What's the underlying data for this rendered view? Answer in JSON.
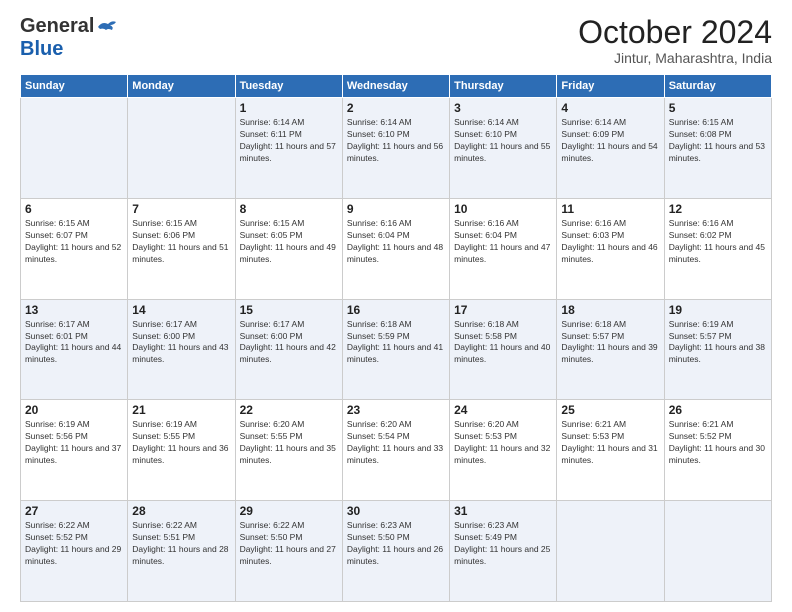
{
  "header": {
    "logo_general": "General",
    "logo_blue": "Blue",
    "month_title": "October 2024",
    "location": "Jintur, Maharashtra, India"
  },
  "days_of_week": [
    "Sunday",
    "Monday",
    "Tuesday",
    "Wednesday",
    "Thursday",
    "Friday",
    "Saturday"
  ],
  "weeks": [
    [
      {
        "day": "",
        "sunrise": "",
        "sunset": "",
        "daylight": ""
      },
      {
        "day": "",
        "sunrise": "",
        "sunset": "",
        "daylight": ""
      },
      {
        "day": "1",
        "sunrise": "Sunrise: 6:14 AM",
        "sunset": "Sunset: 6:11 PM",
        "daylight": "Daylight: 11 hours and 57 minutes."
      },
      {
        "day": "2",
        "sunrise": "Sunrise: 6:14 AM",
        "sunset": "Sunset: 6:10 PM",
        "daylight": "Daylight: 11 hours and 56 minutes."
      },
      {
        "day": "3",
        "sunrise": "Sunrise: 6:14 AM",
        "sunset": "Sunset: 6:10 PM",
        "daylight": "Daylight: 11 hours and 55 minutes."
      },
      {
        "day": "4",
        "sunrise": "Sunrise: 6:14 AM",
        "sunset": "Sunset: 6:09 PM",
        "daylight": "Daylight: 11 hours and 54 minutes."
      },
      {
        "day": "5",
        "sunrise": "Sunrise: 6:15 AM",
        "sunset": "Sunset: 6:08 PM",
        "daylight": "Daylight: 11 hours and 53 minutes."
      }
    ],
    [
      {
        "day": "6",
        "sunrise": "Sunrise: 6:15 AM",
        "sunset": "Sunset: 6:07 PM",
        "daylight": "Daylight: 11 hours and 52 minutes."
      },
      {
        "day": "7",
        "sunrise": "Sunrise: 6:15 AM",
        "sunset": "Sunset: 6:06 PM",
        "daylight": "Daylight: 11 hours and 51 minutes."
      },
      {
        "day": "8",
        "sunrise": "Sunrise: 6:15 AM",
        "sunset": "Sunset: 6:05 PM",
        "daylight": "Daylight: 11 hours and 49 minutes."
      },
      {
        "day": "9",
        "sunrise": "Sunrise: 6:16 AM",
        "sunset": "Sunset: 6:04 PM",
        "daylight": "Daylight: 11 hours and 48 minutes."
      },
      {
        "day": "10",
        "sunrise": "Sunrise: 6:16 AM",
        "sunset": "Sunset: 6:04 PM",
        "daylight": "Daylight: 11 hours and 47 minutes."
      },
      {
        "day": "11",
        "sunrise": "Sunrise: 6:16 AM",
        "sunset": "Sunset: 6:03 PM",
        "daylight": "Daylight: 11 hours and 46 minutes."
      },
      {
        "day": "12",
        "sunrise": "Sunrise: 6:16 AM",
        "sunset": "Sunset: 6:02 PM",
        "daylight": "Daylight: 11 hours and 45 minutes."
      }
    ],
    [
      {
        "day": "13",
        "sunrise": "Sunrise: 6:17 AM",
        "sunset": "Sunset: 6:01 PM",
        "daylight": "Daylight: 11 hours and 44 minutes."
      },
      {
        "day": "14",
        "sunrise": "Sunrise: 6:17 AM",
        "sunset": "Sunset: 6:00 PM",
        "daylight": "Daylight: 11 hours and 43 minutes."
      },
      {
        "day": "15",
        "sunrise": "Sunrise: 6:17 AM",
        "sunset": "Sunset: 6:00 PM",
        "daylight": "Daylight: 11 hours and 42 minutes."
      },
      {
        "day": "16",
        "sunrise": "Sunrise: 6:18 AM",
        "sunset": "Sunset: 5:59 PM",
        "daylight": "Daylight: 11 hours and 41 minutes."
      },
      {
        "day": "17",
        "sunrise": "Sunrise: 6:18 AM",
        "sunset": "Sunset: 5:58 PM",
        "daylight": "Daylight: 11 hours and 40 minutes."
      },
      {
        "day": "18",
        "sunrise": "Sunrise: 6:18 AM",
        "sunset": "Sunset: 5:57 PM",
        "daylight": "Daylight: 11 hours and 39 minutes."
      },
      {
        "day": "19",
        "sunrise": "Sunrise: 6:19 AM",
        "sunset": "Sunset: 5:57 PM",
        "daylight": "Daylight: 11 hours and 38 minutes."
      }
    ],
    [
      {
        "day": "20",
        "sunrise": "Sunrise: 6:19 AM",
        "sunset": "Sunset: 5:56 PM",
        "daylight": "Daylight: 11 hours and 37 minutes."
      },
      {
        "day": "21",
        "sunrise": "Sunrise: 6:19 AM",
        "sunset": "Sunset: 5:55 PM",
        "daylight": "Daylight: 11 hours and 36 minutes."
      },
      {
        "day": "22",
        "sunrise": "Sunrise: 6:20 AM",
        "sunset": "Sunset: 5:55 PM",
        "daylight": "Daylight: 11 hours and 35 minutes."
      },
      {
        "day": "23",
        "sunrise": "Sunrise: 6:20 AM",
        "sunset": "Sunset: 5:54 PM",
        "daylight": "Daylight: 11 hours and 33 minutes."
      },
      {
        "day": "24",
        "sunrise": "Sunrise: 6:20 AM",
        "sunset": "Sunset: 5:53 PM",
        "daylight": "Daylight: 11 hours and 32 minutes."
      },
      {
        "day": "25",
        "sunrise": "Sunrise: 6:21 AM",
        "sunset": "Sunset: 5:53 PM",
        "daylight": "Daylight: 11 hours and 31 minutes."
      },
      {
        "day": "26",
        "sunrise": "Sunrise: 6:21 AM",
        "sunset": "Sunset: 5:52 PM",
        "daylight": "Daylight: 11 hours and 30 minutes."
      }
    ],
    [
      {
        "day": "27",
        "sunrise": "Sunrise: 6:22 AM",
        "sunset": "Sunset: 5:52 PM",
        "daylight": "Daylight: 11 hours and 29 minutes."
      },
      {
        "day": "28",
        "sunrise": "Sunrise: 6:22 AM",
        "sunset": "Sunset: 5:51 PM",
        "daylight": "Daylight: 11 hours and 28 minutes."
      },
      {
        "day": "29",
        "sunrise": "Sunrise: 6:22 AM",
        "sunset": "Sunset: 5:50 PM",
        "daylight": "Daylight: 11 hours and 27 minutes."
      },
      {
        "day": "30",
        "sunrise": "Sunrise: 6:23 AM",
        "sunset": "Sunset: 5:50 PM",
        "daylight": "Daylight: 11 hours and 26 minutes."
      },
      {
        "day": "31",
        "sunrise": "Sunrise: 6:23 AM",
        "sunset": "Sunset: 5:49 PM",
        "daylight": "Daylight: 11 hours and 25 minutes."
      },
      {
        "day": "",
        "sunrise": "",
        "sunset": "",
        "daylight": ""
      },
      {
        "day": "",
        "sunrise": "",
        "sunset": "",
        "daylight": ""
      }
    ]
  ]
}
